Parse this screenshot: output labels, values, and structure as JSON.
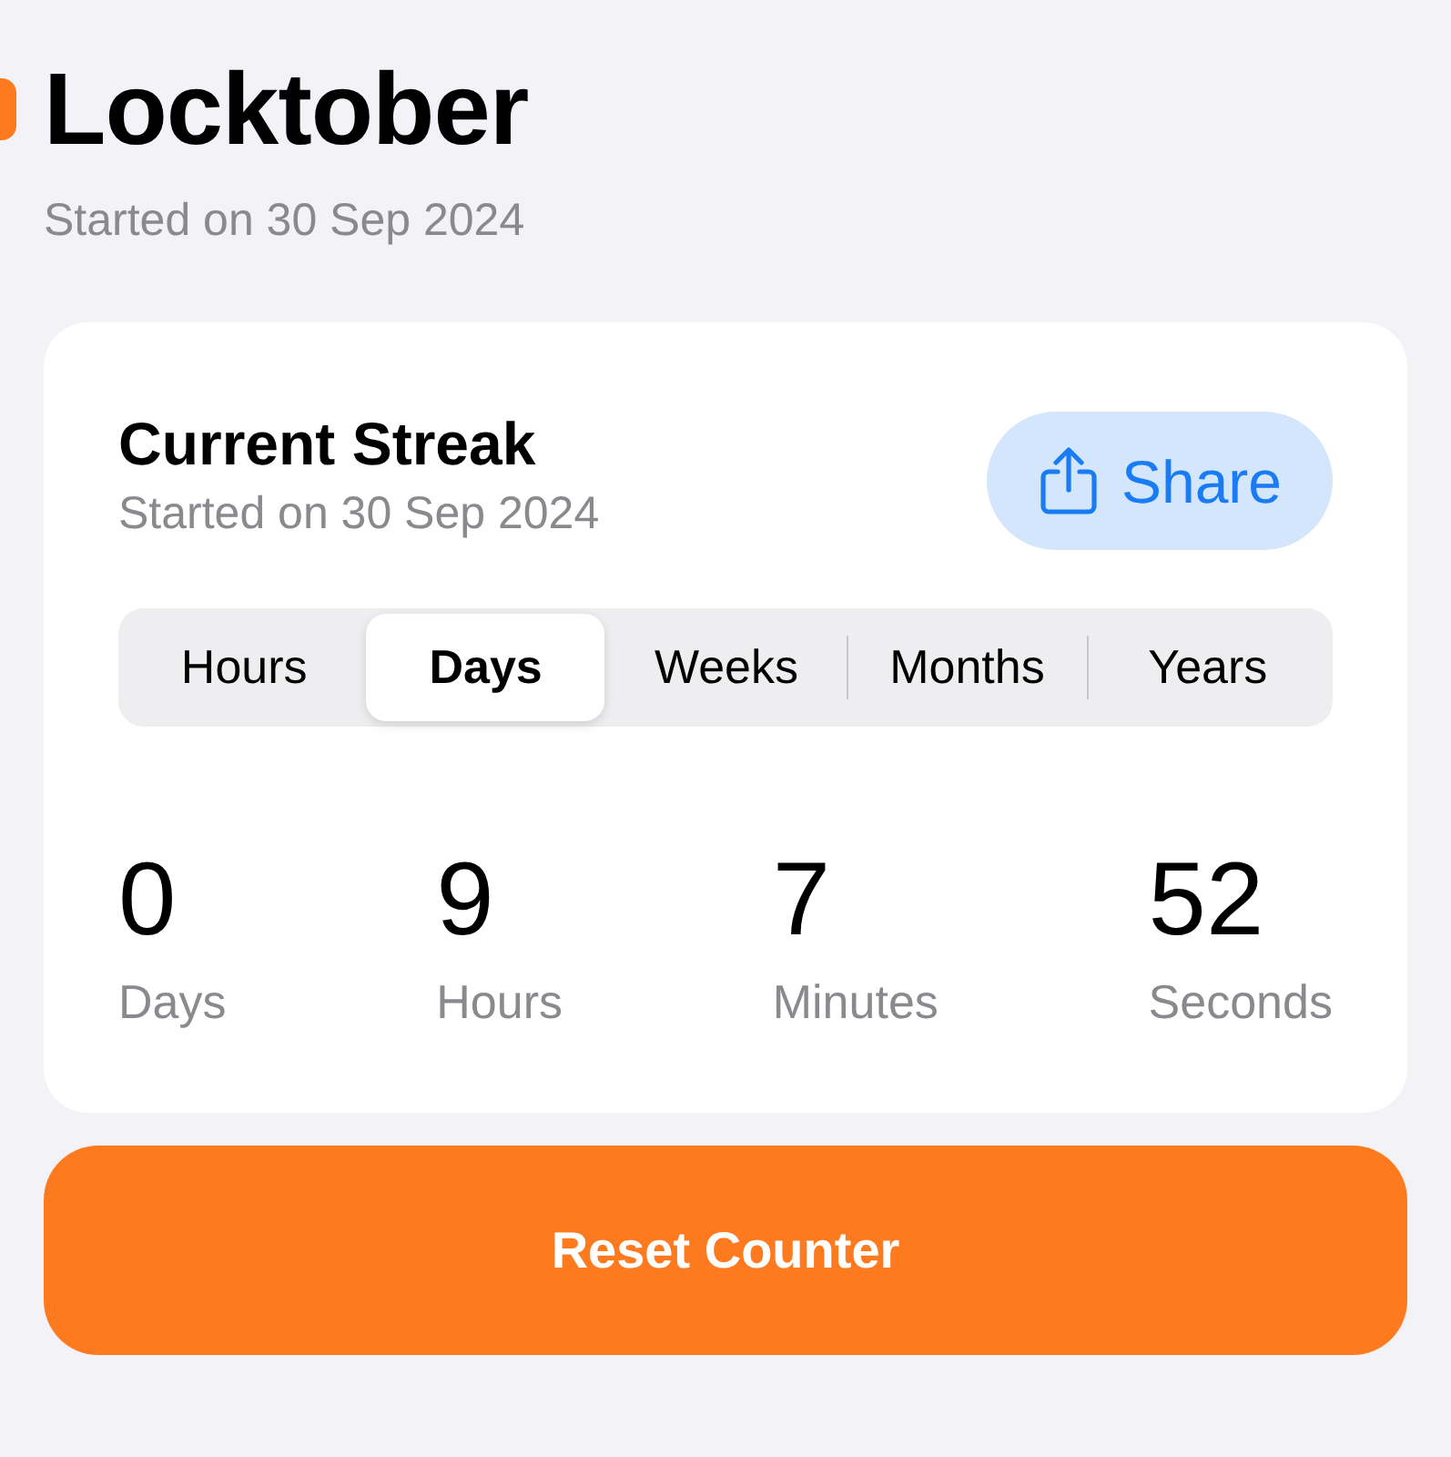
{
  "header": {
    "title": "Locktober",
    "subtitle": "Started on 30 Sep 2024"
  },
  "streak_card": {
    "title": "Current Streak",
    "subtitle": "Started on 30 Sep 2024",
    "share_button": "Share",
    "units": [
      {
        "label": "Hours",
        "selected": false
      },
      {
        "label": "Days",
        "selected": true
      },
      {
        "label": "Weeks",
        "selected": false
      },
      {
        "label": "Months",
        "selected": false
      },
      {
        "label": "Years",
        "selected": false
      }
    ],
    "counters": [
      {
        "value": "0",
        "unit": "Days"
      },
      {
        "value": "9",
        "unit": "Hours"
      },
      {
        "value": "7",
        "unit": "Minutes"
      },
      {
        "value": "52",
        "unit": "Seconds"
      }
    ]
  },
  "reset_button": "Reset Counter"
}
